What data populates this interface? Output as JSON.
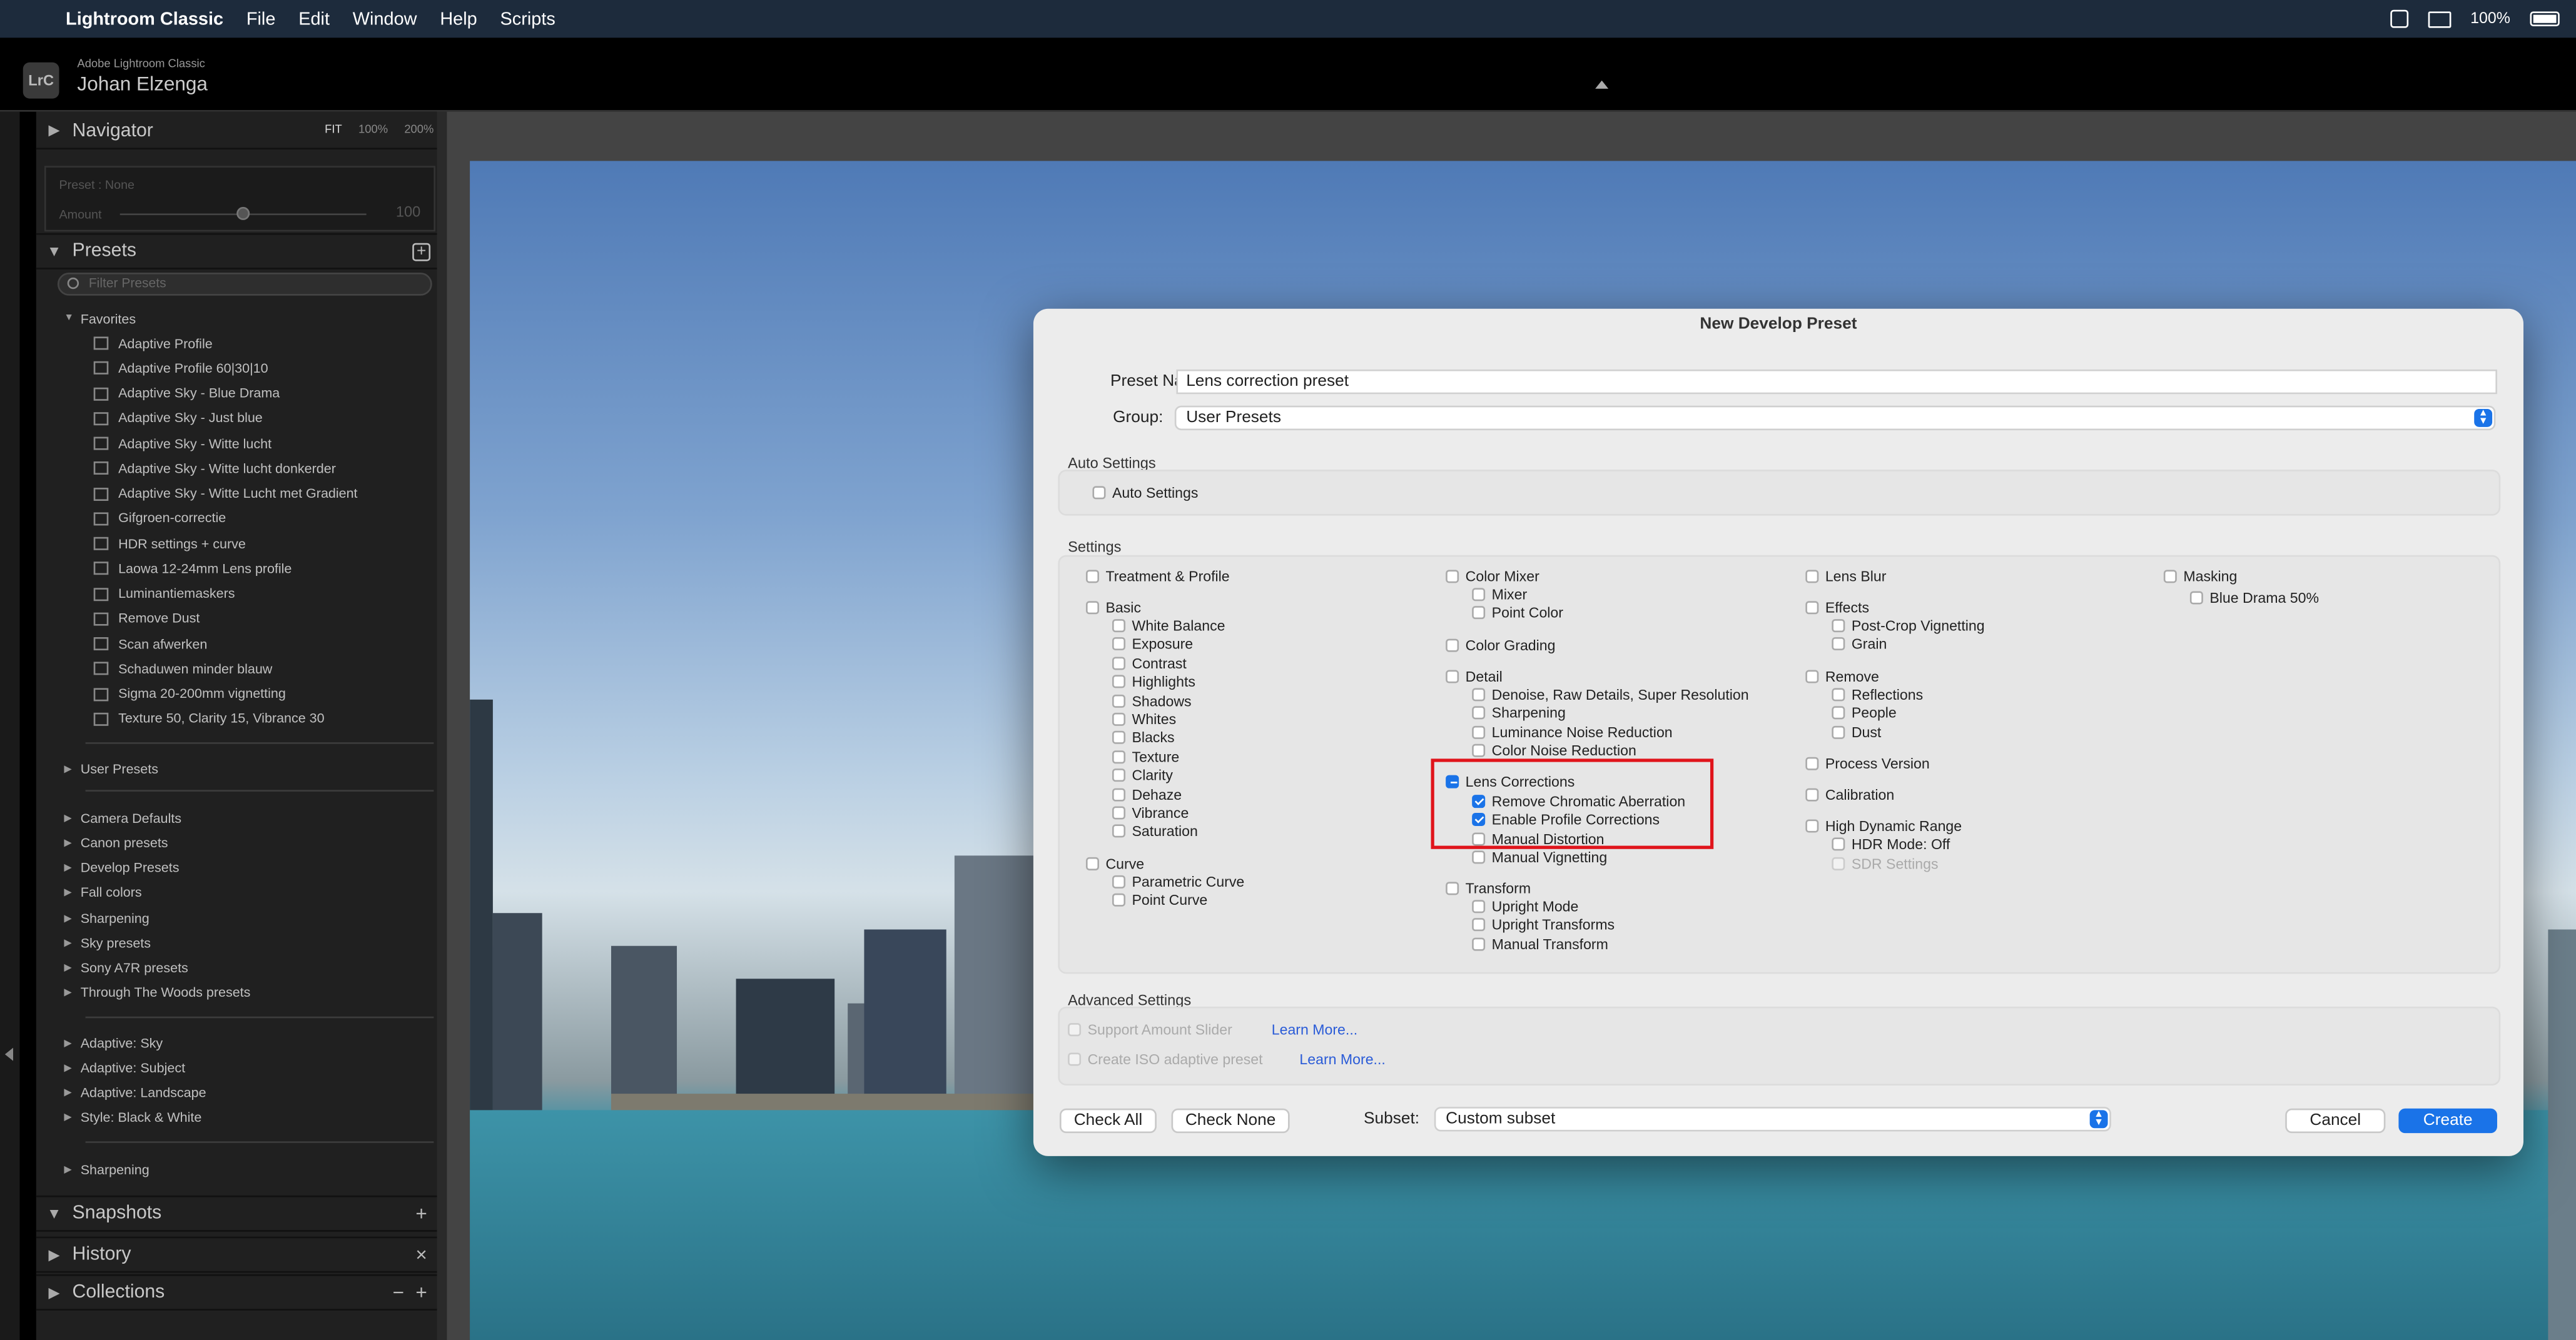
{
  "menubar": {
    "app": "Lightroom Classic",
    "items": [
      "File",
      "Edit",
      "Window",
      "Help",
      "Scripts"
    ],
    "battery": "100%"
  },
  "identity": {
    "logo": "LrC",
    "product": "Adobe Lightroom Classic",
    "user": "Johan Elzenga"
  },
  "navigator": {
    "title": "Navigator",
    "zoom": [
      "FIT",
      "100%",
      "200%"
    ]
  },
  "preset_amount": {
    "preset_label": "Preset : None",
    "amount_label": "Amount",
    "amount_value": "100",
    "amount_level": 0.5
  },
  "presets": {
    "title": "Presets",
    "filter_placeholder": "Filter Presets",
    "favorites_label": "Favorites",
    "favorites": [
      "Adaptive Profile",
      "Adaptive Profile 60|30|10",
      "Adaptive Sky - Blue Drama",
      "Adaptive Sky - Just blue",
      "Adaptive Sky - Witte lucht",
      "Adaptive Sky - Witte lucht donkerder",
      "Adaptive Sky - Witte Lucht met Gradient",
      "Gifgroen-correctie",
      "HDR settings + curve",
      "Laowa 12-24mm Lens profile",
      "Luminantiemaskers",
      "Remove Dust",
      "Scan afwerken",
      "Schaduwen minder blauw",
      "Sigma 20-200mm vignetting",
      "Texture 50, Clarity 15, Vibrance 30"
    ],
    "groups_a": [
      "User Presets"
    ],
    "groups_b": [
      "Camera Defaults",
      "Canon presets",
      "Develop Presets",
      "Fall colors",
      "Sharpening",
      "Sky presets",
      "Sony A7R presets",
      "Through The Woods presets"
    ],
    "groups_c": [
      "Adaptive: Sky",
      "Adaptive: Subject",
      "Adaptive: Landscape",
      "Style: Black & White"
    ],
    "groups_d": [
      "Sharpening"
    ]
  },
  "bottom_panels": {
    "snapshots": "Snapshots",
    "history": "History",
    "collections": "Collections"
  },
  "dialog": {
    "title": "New Develop Preset",
    "preset_name_label": "Preset Name:",
    "preset_name_value": "Lens correction preset",
    "group_label": "Group:",
    "group_value": "User Presets",
    "auto_settings_section": "Auto Settings",
    "auto_settings_item": "Auto Settings",
    "settings_section": "Settings",
    "col1": {
      "treatment": "Treatment & Profile",
      "basic": "Basic",
      "basic_items": [
        "White Balance",
        "Exposure",
        "Contrast",
        "Highlights",
        "Shadows",
        "Whites",
        "Blacks",
        "Texture",
        "Clarity",
        "Dehaze",
        "Vibrance",
        "Saturation"
      ],
      "curve": "Curve",
      "curve_items": [
        "Parametric Curve",
        "Point Curve"
      ]
    },
    "col2": {
      "color_mixer": "Color Mixer",
      "color_mixer_items": [
        "Mixer",
        "Point Color"
      ],
      "color_grading": "Color Grading",
      "detail": "Detail",
      "detail_items": [
        "Denoise, Raw Details, Super Resolution",
        "Sharpening",
        "Luminance Noise Reduction",
        "Color Noise Reduction"
      ],
      "lens": "Lens Corrections",
      "lens_items": [
        "Remove Chromatic Aberration",
        "Enable Profile Corrections",
        "Manual Distortion",
        "Manual Vignetting"
      ],
      "lens_checked": [
        true,
        true,
        false,
        false
      ],
      "transform": "Transform",
      "transform_items": [
        "Upright Mode",
        "Upright Transforms",
        "Manual Transform"
      ]
    },
    "col3": {
      "lens_blur": "Lens Blur",
      "effects": "Effects",
      "effects_items": [
        "Post-Crop Vignetting",
        "Grain"
      ],
      "remove": "Remove",
      "remove_items": [
        "Reflections",
        "People",
        "Dust"
      ],
      "process": "Process Version",
      "calibration": "Calibration",
      "hdr": "High Dynamic Range",
      "hdr_items": [
        "HDR Mode: Off",
        "SDR Settings"
      ]
    },
    "col4": {
      "masking": "Masking",
      "masking_items": [
        "Blue Drama 50%"
      ]
    },
    "advanced_section": "Advanced Settings",
    "support_amount": "Support Amount Slider",
    "create_iso": "Create ISO adaptive preset",
    "learn_more": "Learn More...",
    "check_all": "Check All",
    "check_none": "Check None",
    "subset_label": "Subset:",
    "subset_value": "Custom subset",
    "cancel": "Cancel",
    "create": "Create"
  },
  "colors": {
    "accent": "#1a73e8",
    "highlight": "#e0141b"
  }
}
